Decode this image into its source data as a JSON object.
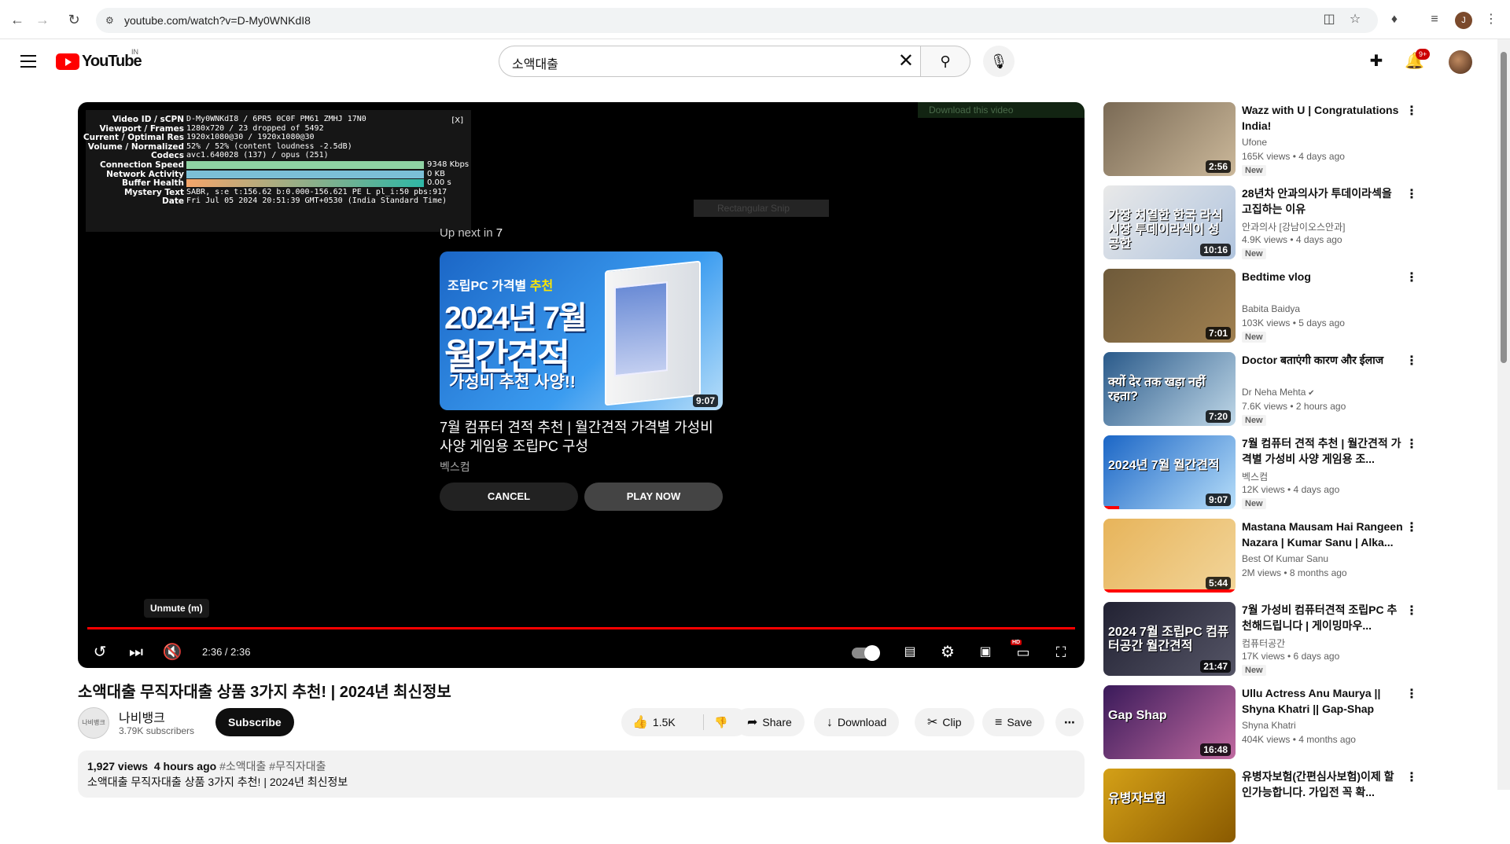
{
  "browser": {
    "url": "youtube.com/watch?v=D-My0WNKdI8"
  },
  "header": {
    "logo_text": "YouTube",
    "country_code": "IN",
    "search_value": "소액대출",
    "notification_badge": "9+"
  },
  "player": {
    "stats": {
      "close_label": "[X]",
      "rows": [
        {
          "key": "Video ID / sCPN",
          "value": "D-My0WNKdI8 / 6PR5 0C0F PM61 ZMHJ 17N0"
        },
        {
          "key": "Viewport / Frames",
          "value": "1280x720 / 23 dropped of 5492"
        },
        {
          "key": "Current / Optimal Res",
          "value": "1920x1080@30 / 1920x1080@30"
        },
        {
          "key": "Volume / Normalized",
          "value": "52% / 52% (content loudness -2.5dB)"
        },
        {
          "key": "Codecs",
          "value": "avc1.640028 (137) / opus (251)"
        },
        {
          "key": "Connection Speed",
          "value": "9348 Kbps"
        },
        {
          "key": "Network Activity",
          "value": "0 KB"
        },
        {
          "key": "Buffer Health",
          "value": "0.00 s"
        },
        {
          "key": "Mystery Text",
          "value": "SABR, s:e t:156.62 b:0.000-156.621 PE L pl_i:50 pbs:917"
        },
        {
          "key": "Date",
          "value": "Fri Jul 05 2024 20:51:39 GMT+0530 (India Standard Time)"
        }
      ]
    },
    "ghost_download": "Download this video",
    "ghost_snip": "Rectangular Snip",
    "upnext": {
      "label": "Up next in",
      "countdown": "7",
      "thumb_line1": "조립PC 가격별",
      "thumb_line1_accent": "추천",
      "thumb_line2": "2024년 7월",
      "thumb_line3": "월간견적",
      "thumb_line4": "가성비 추천 사양!!",
      "duration": "9:07",
      "title": "7월 컴퓨터 견적 추천 | 월간견적 가격별 가성비 사양 게임용 조립PC 구성",
      "channel": "벡스컴",
      "cancel_label": "CANCEL",
      "play_label": "PLAY NOW"
    },
    "tooltip": "Unmute (m)",
    "time": "2:36 / 2:36",
    "progress": 1.0,
    "hd_badge": "HD"
  },
  "video": {
    "title": "소액대출 무직자대출 상품 3가지 추천! | 2024년 최신정보",
    "channel": "나비뱅크",
    "channel_avatar_text": "나비뱅크",
    "subscribers": "3.79K subscribers",
    "subscribe_label": "Subscribe",
    "likes": "1.5K",
    "share_label": "Share",
    "download_label": "Download",
    "clip_label": "Clip",
    "save_label": "Save",
    "views": "1,927 views",
    "age": "4 hours ago",
    "tags": "#소액대출 #무직자대출",
    "description": "소액대출 무직자대출 상품 3가지 추천! | 2024년 최신정보"
  },
  "sidebar": [
    {
      "title": "Wazz with U | Congratulations India!",
      "channel": "Ufone",
      "meta": "165K views • 4 days ago",
      "badge": "New",
      "duration": "2:56",
      "verified": false,
      "watched": 0
    },
    {
      "title": "28년차 안과의사가 투데이라섹을 고집하는 이유",
      "channel": "안과의사 [강남이오스안과]",
      "meta": "4.9K views • 4 days ago",
      "badge": "New",
      "duration": "10:16",
      "verified": false,
      "watched": 0,
      "thumb_text": "가장 치열한 한국 라식 시장 투데이라섹이 성공한"
    },
    {
      "title": "Bedtime vlog",
      "channel": "Babita Baidya",
      "meta": "103K views • 5 days ago",
      "badge": "New",
      "duration": "7:01",
      "verified": false,
      "watched": 0
    },
    {
      "title": "Doctor बताएंगी कारण और ईलाज",
      "channel": "Dr Neha Mehta",
      "meta": "7.6K views • 2 hours ago",
      "badge": "New",
      "duration": "7:20",
      "verified": true,
      "watched": 0,
      "thumb_text": "क्यों देर तक खड़ा नहीं रहता?"
    },
    {
      "title": "7월 컴퓨터 견적 추천 | 월간견적 가격별 가성비 사양 게임용 조...",
      "channel": "벡스컴",
      "meta": "12K views • 4 days ago",
      "badge": "New",
      "duration": "9:07",
      "verified": false,
      "watched": 0.12,
      "thumb_text": "2024년 7월 월간견적"
    },
    {
      "title": "Mastana Mausam Hai Rangeen Nazara | Kumar Sanu | Alka...",
      "channel": "Best Of Kumar Sanu",
      "meta": "2M views • 8 months ago",
      "badge": "",
      "duration": "5:44",
      "verified": false,
      "watched": 1.0
    },
    {
      "title": "7월 가성비 컴퓨터견적 조립PC 추천해드립니다 | 게이밍마우...",
      "channel": "컴퓨터공간",
      "meta": "17K views • 6 days ago",
      "badge": "New",
      "duration": "21:47",
      "verified": false,
      "watched": 0,
      "thumb_text": "2024 7월 조립PC 컴퓨터공간 월간견적"
    },
    {
      "title": "Ullu Actress Anu Maurya || Shyna Khatri || Gap-Shap with...",
      "channel": "Shyna Khatri",
      "meta": "404K views • 4 months ago",
      "badge": "",
      "duration": "16:48",
      "verified": false,
      "watched": 0,
      "thumb_text": "Gap Shap"
    },
    {
      "title": "유병자보험(간편심사보험)이제 할인가능합니다. 가입전 꼭 확...",
      "channel": "",
      "meta": "",
      "badge": "",
      "duration": "",
      "verified": false,
      "watched": 0,
      "thumb_text": "유병자보험"
    }
  ]
}
